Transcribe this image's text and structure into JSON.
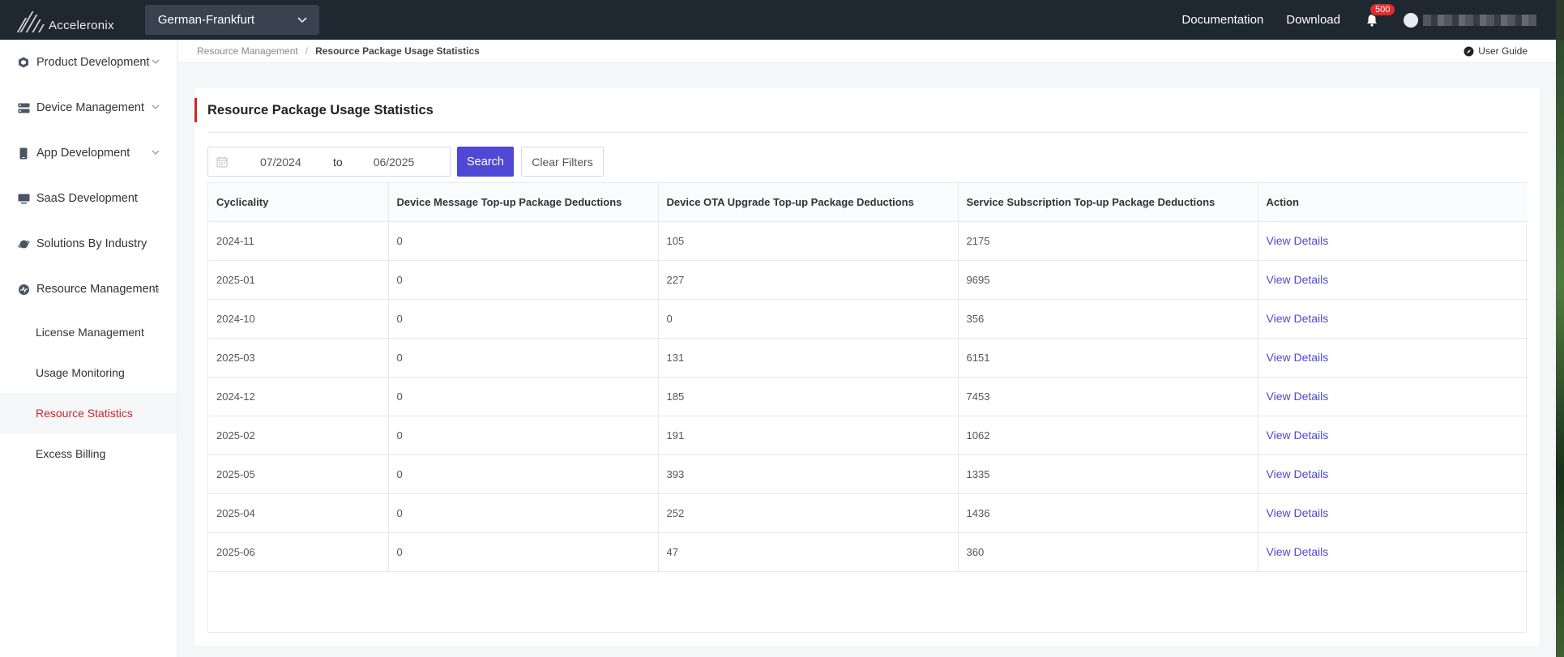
{
  "header": {
    "brand": "Acceleronix",
    "region": "German-Frankfurt",
    "links": {
      "documentation": "Documentation",
      "download": "Download"
    },
    "notification_count": "500"
  },
  "sidebar": {
    "items": [
      {
        "label": "Product Development",
        "icon": "cube-icon"
      },
      {
        "label": "Device Management",
        "icon": "server-icon"
      },
      {
        "label": "App Development",
        "icon": "phone-icon"
      },
      {
        "label": "SaaS Development",
        "icon": "monitor-icon"
      },
      {
        "label": "Solutions By Industry",
        "icon": "planet-icon"
      },
      {
        "label": "Resource Management",
        "icon": "gauge-icon"
      }
    ],
    "sub_items": [
      {
        "label": "License Management"
      },
      {
        "label": "Usage Monitoring"
      },
      {
        "label": "Resource Statistics"
      },
      {
        "label": "Excess Billing"
      }
    ]
  },
  "breadcrumb": {
    "parent": "Resource Management",
    "separator": "/",
    "current": "Resource Package Usage Statistics",
    "user_guide": "User Guide"
  },
  "page": {
    "title": "Resource Package Usage Statistics",
    "filters": {
      "start": "07/2024",
      "to": "to",
      "end": "06/2025",
      "search": "Search",
      "clear": "Clear Filters"
    }
  },
  "table": {
    "columns": [
      "Cyclicality",
      "Device Message Top-up Package Deductions",
      "Device OTA Upgrade Top-up Package Deductions",
      "Service Subscription Top-up Package Deductions",
      "Action"
    ],
    "rows": [
      {
        "cycle": "2024-11",
        "msg": "0",
        "ota": "105",
        "sub": "2175",
        "action": "View Details"
      },
      {
        "cycle": "2025-01",
        "msg": "0",
        "ota": "227",
        "sub": "9695",
        "action": "View Details"
      },
      {
        "cycle": "2024-10",
        "msg": "0",
        "ota": "0",
        "sub": "356",
        "action": "View Details"
      },
      {
        "cycle": "2025-03",
        "msg": "0",
        "ota": "131",
        "sub": "6151",
        "action": "View Details"
      },
      {
        "cycle": "2024-12",
        "msg": "0",
        "ota": "185",
        "sub": "7453",
        "action": "View Details"
      },
      {
        "cycle": "2025-02",
        "msg": "0",
        "ota": "191",
        "sub": "1062",
        "action": "View Details"
      },
      {
        "cycle": "2025-05",
        "msg": "0",
        "ota": "393",
        "sub": "1335",
        "action": "View Details"
      },
      {
        "cycle": "2025-04",
        "msg": "0",
        "ota": "252",
        "sub": "1436",
        "action": "View Details"
      },
      {
        "cycle": "2025-06",
        "msg": "0",
        "ota": "47",
        "sub": "360",
        "action": "View Details"
      }
    ]
  },
  "colors": {
    "topbar": "#1f2731",
    "accent_red": "#c8282e",
    "primary_purple": "#4e48d5"
  }
}
